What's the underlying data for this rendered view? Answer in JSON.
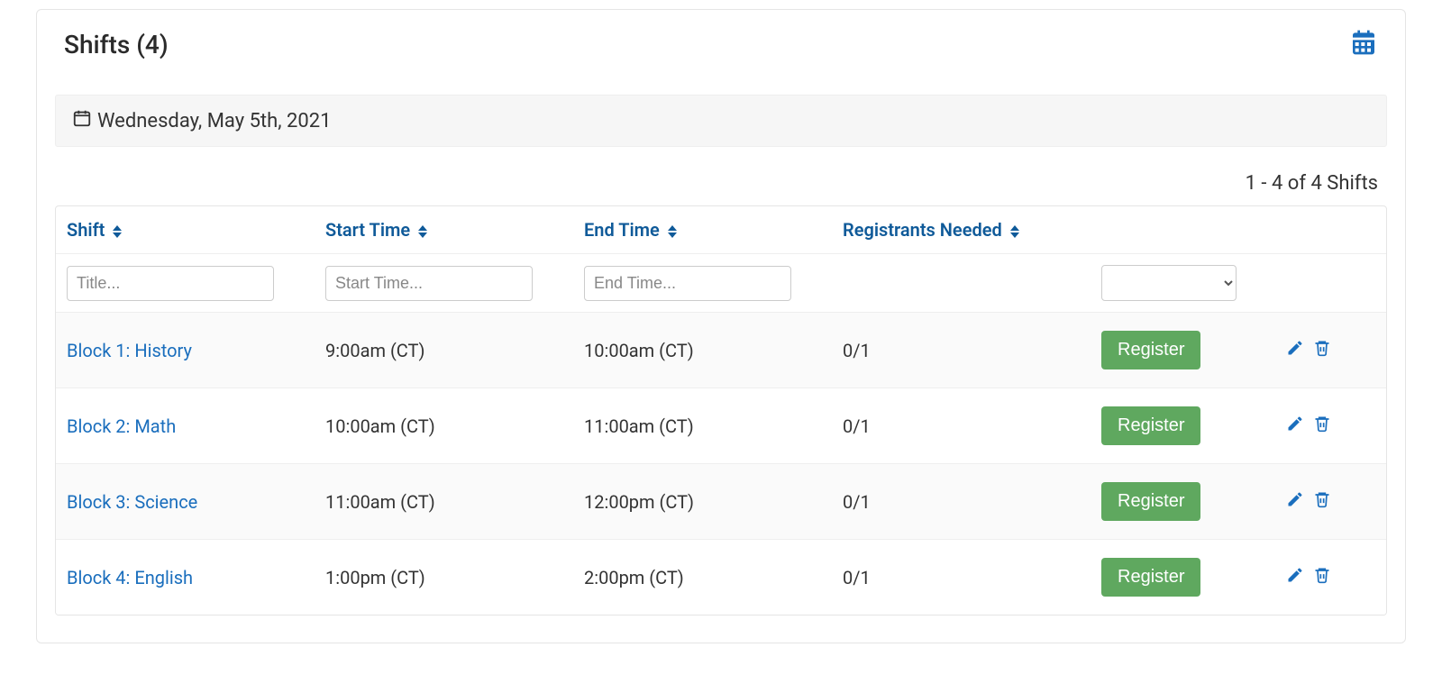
{
  "panel": {
    "title": "Shifts (4)",
    "date_label": "Wednesday, May 5th, 2021",
    "results_summary": "1 - 4 of 4 Shifts"
  },
  "columns": {
    "shift": "Shift",
    "start": "Start Time",
    "end": "End Time",
    "registrants": "Registrants Needed"
  },
  "filters": {
    "title_placeholder": "Title...",
    "start_placeholder": "Start Time...",
    "end_placeholder": "End Time..."
  },
  "register_label": "Register",
  "rows": [
    {
      "title": "Block 1: History",
      "start": "9:00am (CT)",
      "end": "10:00am (CT)",
      "registrants": "0/1"
    },
    {
      "title": "Block 2: Math",
      "start": "10:00am (CT)",
      "end": "11:00am (CT)",
      "registrants": "0/1"
    },
    {
      "title": "Block 3: Science",
      "start": "11:00am (CT)",
      "end": "12:00pm (CT)",
      "registrants": "0/1"
    },
    {
      "title": "Block 4: English",
      "start": "1:00pm (CT)",
      "end": "2:00pm (CT)",
      "registrants": "0/1"
    }
  ]
}
